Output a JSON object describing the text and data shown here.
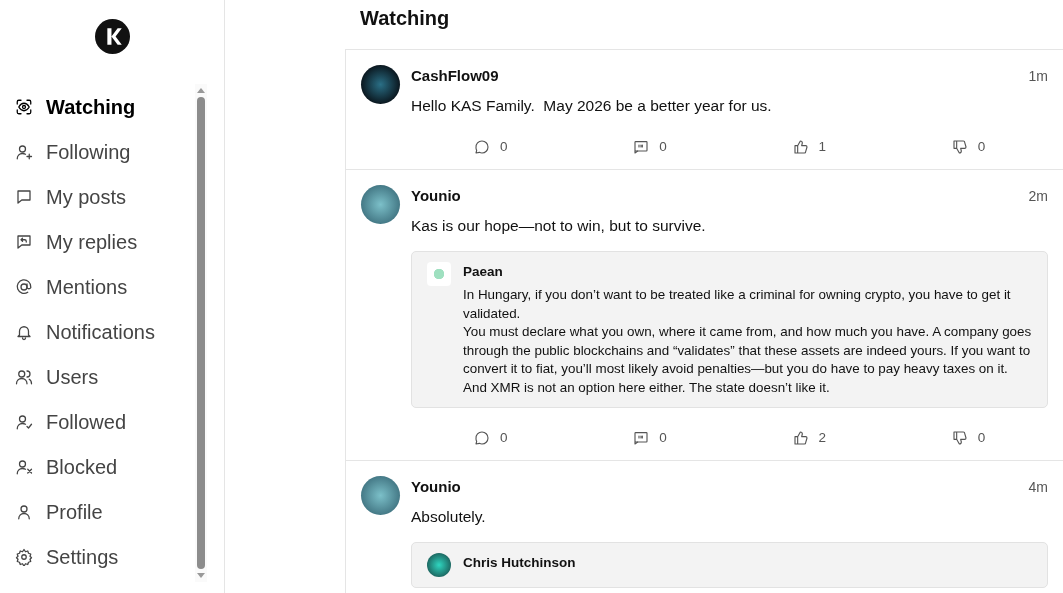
{
  "sidebar": {
    "items": [
      {
        "label": "Watching",
        "selected": true
      },
      {
        "label": "Following",
        "selected": false
      },
      {
        "label": "My posts",
        "selected": false
      },
      {
        "label": "My replies",
        "selected": false
      },
      {
        "label": "Mentions",
        "selected": false
      },
      {
        "label": "Notifications",
        "selected": false
      },
      {
        "label": "Users",
        "selected": false
      },
      {
        "label": "Followed",
        "selected": false
      },
      {
        "label": "Blocked",
        "selected": false
      },
      {
        "label": "Profile",
        "selected": false
      },
      {
        "label": "Settings",
        "selected": false
      }
    ]
  },
  "page_title": "Watching",
  "posts": [
    {
      "author": "CashFlow09",
      "time": "1m",
      "text": "Hello KAS Family.  May 2026 be a better year for us.",
      "actions": [
        {
          "kind": "comment",
          "count": "0"
        },
        {
          "kind": "quote",
          "count": "0"
        },
        {
          "kind": "like",
          "count": "1"
        },
        {
          "kind": "dislike",
          "count": "0"
        }
      ]
    },
    {
      "author": "Younio",
      "time": "2m",
      "text": "Kas is our hope—not to win, but to survive.",
      "quote": {
        "author": "Paean",
        "paragraphs": [
          "In Hungary, if you don’t want to be treated like a criminal for owning crypto, you have to get it validated.",
          "You must declare what you own, where it came from, and how much you have. A company goes through the public blockchains and “validates” that these assets are indeed yours. If you want to convert it to fiat, you’ll most likely avoid penalties—but you do have to pay heavy taxes on it.",
          "And XMR is not an option here either. The state doesn’t like it."
        ]
      },
      "actions": [
        {
          "kind": "comment",
          "count": "0"
        },
        {
          "kind": "quote",
          "count": "0"
        },
        {
          "kind": "like",
          "count": "2"
        },
        {
          "kind": "dislike",
          "count": "0"
        }
      ]
    },
    {
      "author": "Younio",
      "time": "4m",
      "text": "Absolutely.",
      "quote": {
        "author": "Chris Hutchinson"
      }
    }
  ]
}
